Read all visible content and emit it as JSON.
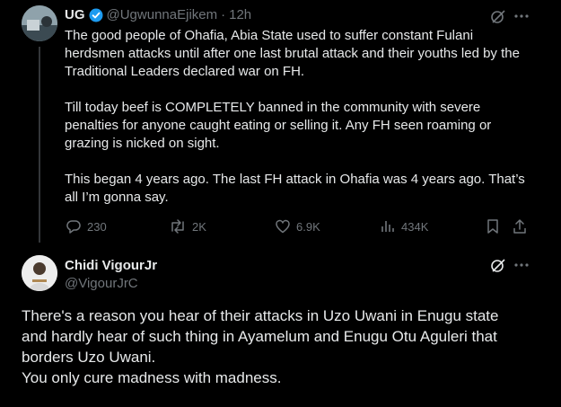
{
  "tweet": {
    "display_name": "UG",
    "handle": "@UgwunnaEjikem",
    "separator": "·",
    "time": "12h",
    "paragraphs": [
      "The good people of Ohafia, Abia State used to suffer constant Fulani herdsmen attacks until after one last brutal attack and their youths led by the Traditional Leaders declared war on FH.",
      "Till today beef is COMPLETELY banned in the community with severe penalties for anyone caught eating or selling it. Any FH seen roaming or grazing is nicked on sight.",
      "This began 4 years ago. The last FH attack in Ohafia was 4 years ago. That’s all I’m gonna say."
    ],
    "stats": {
      "replies": "230",
      "reposts": "2K",
      "likes": "6.9K",
      "views": "434K"
    }
  },
  "reply": {
    "display_name": "Chidi VigourJr",
    "handle": "@VigourJrC",
    "lines": [
      "There's a reason you hear of their attacks in Uzo Uwani in Enugu state",
      "and hardly hear of such thing in Ayamelum and Enugu Otu Aguleri that",
      "borders Uzo Uwani.",
      "You only cure madness with madness."
    ]
  },
  "colors": {
    "background": "#000000",
    "text": "#e7e9ea",
    "muted": "#71767b",
    "verified": "#1d9bf0"
  }
}
